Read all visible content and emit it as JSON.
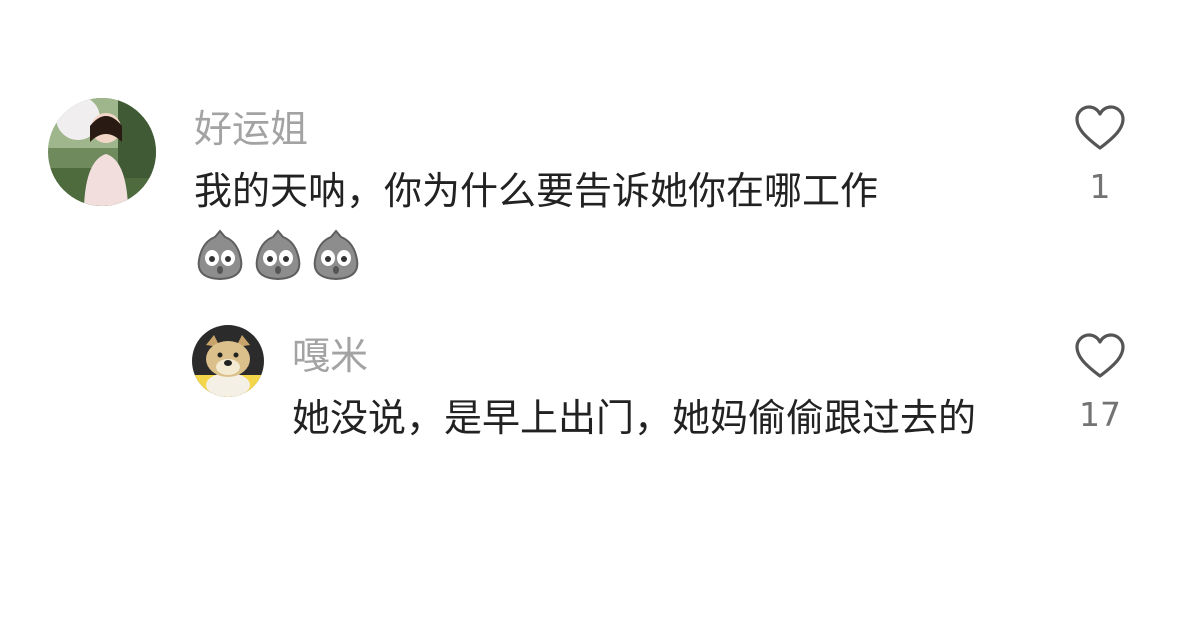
{
  "comments": [
    {
      "username": "好运姐",
      "text": "我的天呐，你为什么要告诉她你在哪工作",
      "emojis": [
        "shocked-ghost-emoji",
        "shocked-ghost-emoji",
        "shocked-ghost-emoji"
      ],
      "like_count": "1",
      "avatar_icon": "girl-photo-avatar"
    }
  ],
  "replies": [
    {
      "username": "嘎米",
      "text": "她没说，是早上出门，她妈偷偷跟过去的",
      "like_count": "17",
      "avatar_icon": "dog-photo-avatar"
    }
  ],
  "colors": {
    "username": "#a3a3a3",
    "text": "#222222",
    "count": "#737373",
    "heart_stroke": "#555555"
  }
}
